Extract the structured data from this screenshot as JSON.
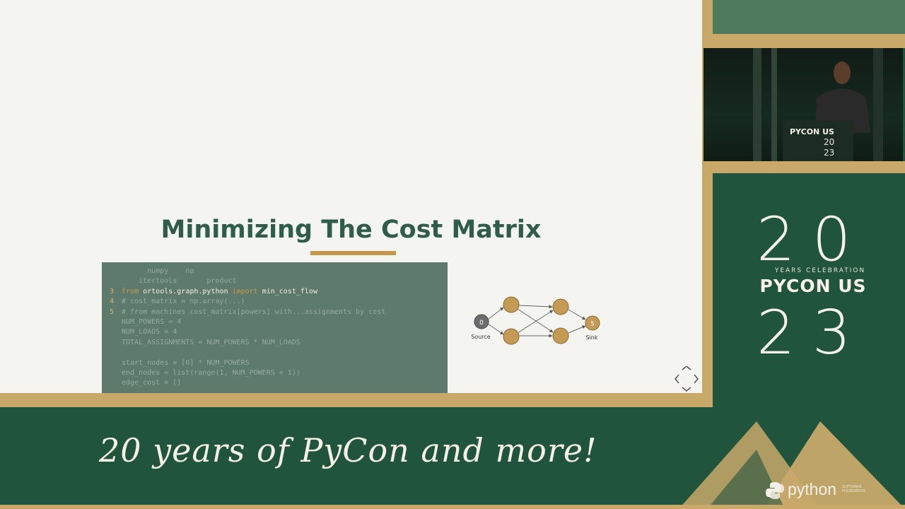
{
  "slide": {
    "title": "Minimizing The Cost Matrix",
    "code_lines": [
      {
        "num": "",
        "text": "      numpy    np",
        "bright": false
      },
      {
        "num": "",
        "text": "    itertools       product",
        "bright": false
      },
      {
        "num": "3",
        "pre": "from ",
        "text": "ortools.graph.python",
        "kw": " import ",
        "post": "min_cost_flow",
        "bright": true
      },
      {
        "num": "4",
        "text": "# cost_matrix = np.array(...)",
        "bright": false
      },
      {
        "num": "5",
        "text": "# from machines cost_matrix[powers] with...assignments by cost",
        "bright": false
      },
      {
        "num": "",
        "text": "NUM_POWERS = 4",
        "bright": false
      },
      {
        "num": "",
        "text": "NUM_LOADS = 4",
        "bright": false
      },
      {
        "num": "",
        "text": "TOTAL_ASSIGNMENTS = NUM_POWERS * NUM_LOADS",
        "bright": false
      },
      {
        "num": "",
        "text": "",
        "bright": false
      },
      {
        "num": "",
        "text": "start_nodes = [0] * NUM_POWERS",
        "bright": false
      },
      {
        "num": "",
        "text": "end_nodes = list(range(1, NUM_POWERS + 1))",
        "bright": false
      },
      {
        "num": "",
        "text": "edge_cost = []",
        "bright": false
      }
    ],
    "diagram": {
      "source_label": "Source",
      "sink_label": "Sink",
      "source_node": "0",
      "sink_node": "5"
    }
  },
  "brand": {
    "year_top": "20",
    "celebration": "YEARS CELEBRATION",
    "pycon_us": "PYCON US",
    "year_bottom": "23",
    "lectern_title": "PYCON US",
    "lectern_year_top": "20",
    "lectern_year_bottom": "23"
  },
  "banner": {
    "tagline": "20 years of PyCon and more!",
    "python_text": "python",
    "psf_text": "SOFTWARE FOUNDATION"
  },
  "colors": {
    "primary_green": "#21543d",
    "gold": "#c8a96a",
    "title_green": "#2f5d4a"
  }
}
